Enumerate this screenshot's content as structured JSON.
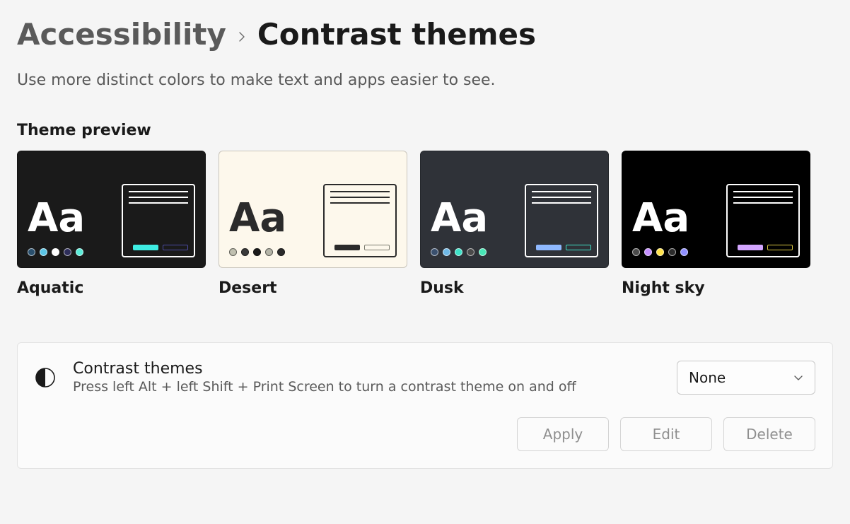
{
  "breadcrumb": {
    "parent": "Accessibility",
    "current": "Contrast themes"
  },
  "description": "Use more distinct colors to make text and apps easier to see.",
  "preview_section_title": "Theme preview",
  "themes": [
    {
      "name": "Aquatic",
      "bg": "#1a1a1a",
      "fg": "#ffffff",
      "swatches": [
        "#2a506e",
        "#5bc5e6",
        "#ffffff",
        "#2e2e5a",
        "#5becd9"
      ],
      "bar1": "#3eece2",
      "bar2_outline": "#4b4ba3"
    },
    {
      "name": "Desert",
      "bg": "#fdf8ec",
      "fg": "#2b2b2b",
      "light": true,
      "swatches": [
        "#c0c0b0",
        "#3a3a3a",
        "#1a1a1a",
        "#b5b5a8",
        "#2b2b2b"
      ],
      "bar1": "#2b2b2b",
      "bar2_outline": "#7a7a6e"
    },
    {
      "name": "Dusk",
      "bg": "#2f3238",
      "fg": "#ffffff",
      "swatches": [
        "#3a506e",
        "#6fb8e6",
        "#3ee2c8",
        "#4a4a4a",
        "#47e6b5"
      ],
      "bar1": "#8fb9ff",
      "bar2_outline": "#3ee2c8"
    },
    {
      "name": "Night sky",
      "bg": "#000000",
      "fg": "#ffffff",
      "swatches": [
        "#4a4a4a",
        "#c48fff",
        "#ffe24a",
        "#2b2b2b",
        "#8f8fff"
      ],
      "bar1": "#d3a6ff",
      "bar2_outline": "#d8c642"
    }
  ],
  "settings": {
    "title": "Contrast themes",
    "subtitle": "Press left Alt + left Shift + Print Screen to turn a contrast theme on and off",
    "selected": "None",
    "buttons": {
      "apply": "Apply",
      "edit": "Edit",
      "delete": "Delete"
    }
  }
}
